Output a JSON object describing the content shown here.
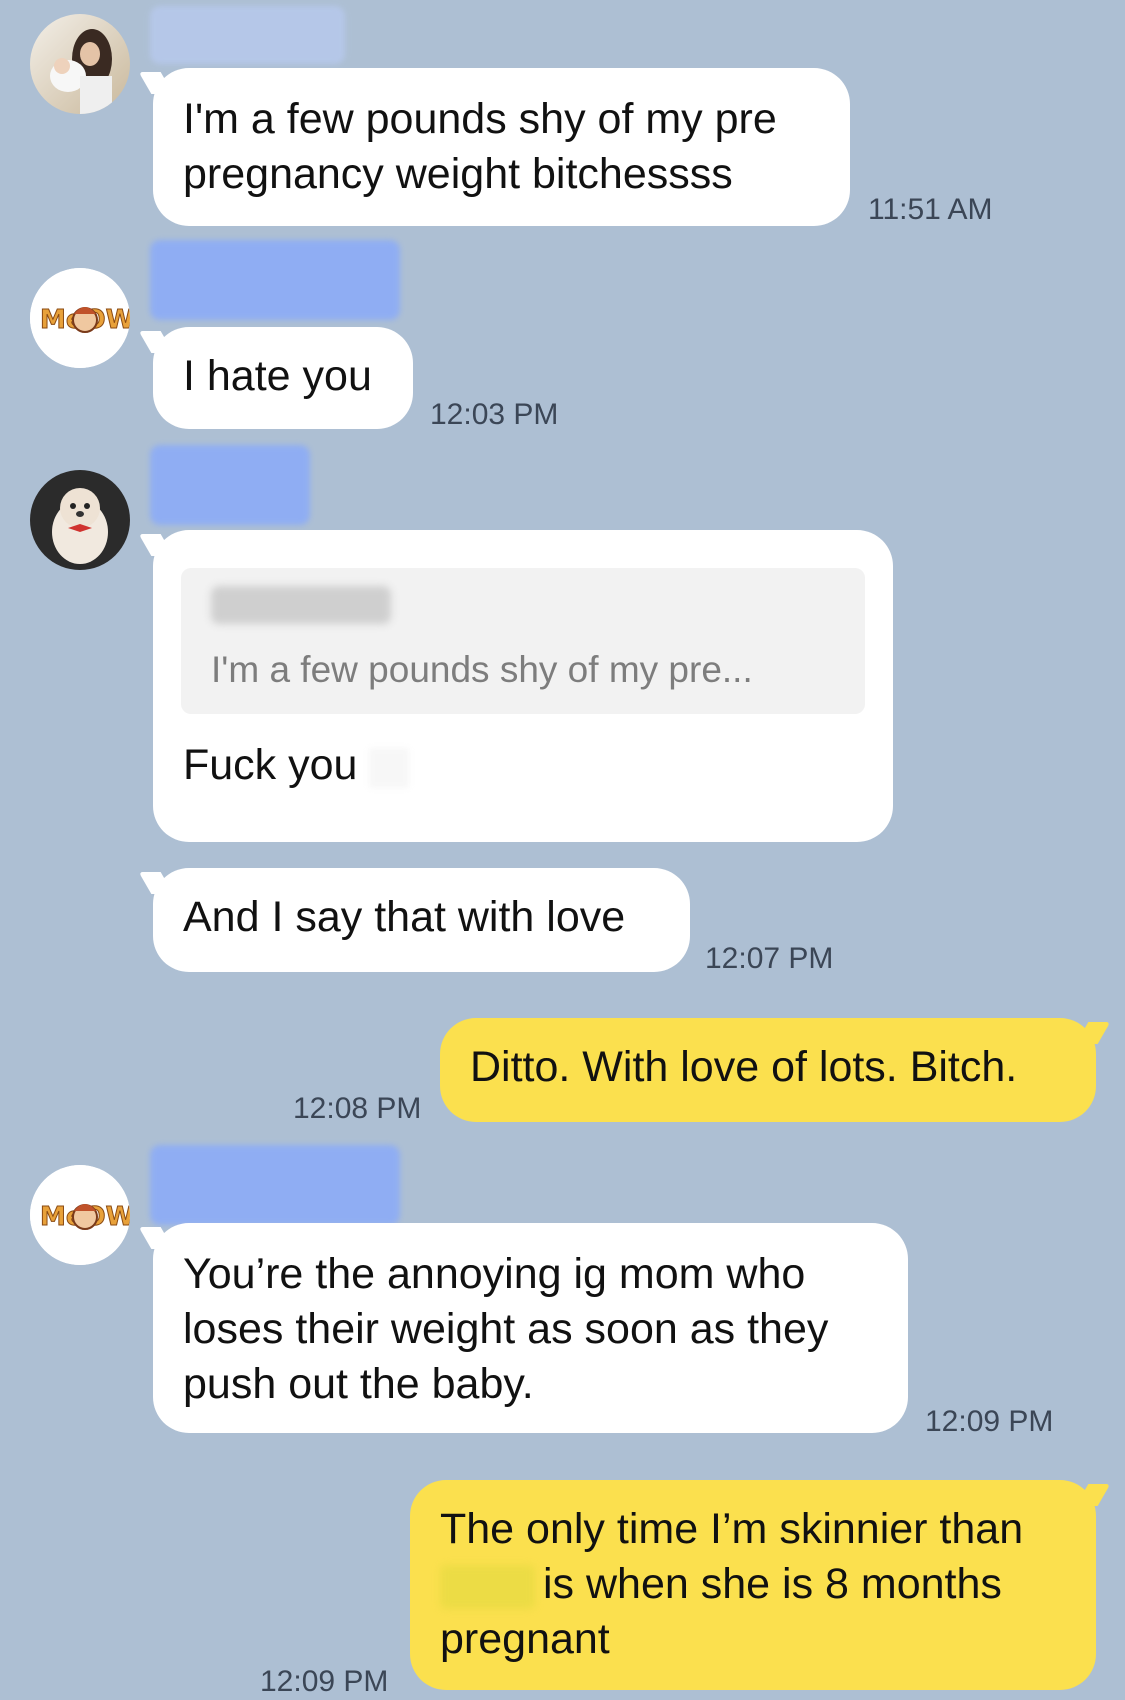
{
  "messages": [
    {
      "id": "m1",
      "text": "I'm a few pounds shy of my pre pregnancy weight bitchessss",
      "time": "11:51 AM"
    },
    {
      "id": "m2",
      "text": "I hate you",
      "time": "12:03 PM"
    },
    {
      "id": "m3",
      "quote": "I'm a few pounds shy of my pre...",
      "text": "Fuck you"
    },
    {
      "id": "m4",
      "text": "And I say that with love",
      "time": "12:07 PM"
    },
    {
      "id": "m5",
      "text": "Ditto. With love of lots. Bitch.",
      "time": "12:08 PM"
    },
    {
      "id": "m6",
      "text": "You’re the annoying ig mom who loses their weight as soon as they push out the baby.",
      "time": "12:09 PM"
    },
    {
      "id": "m7",
      "text_a": "The only time I’m skinnier than",
      "text_b": "is when she is 8 months pregnant",
      "time": "12:09 PM"
    }
  ],
  "avatar_badges": {
    "meow": "MeOW"
  },
  "colors": {
    "background": "#adbfd3",
    "incoming_bubble": "#ffffff",
    "outgoing_bubble": "#fbe04e",
    "name_redaction": "#8eadf5"
  }
}
